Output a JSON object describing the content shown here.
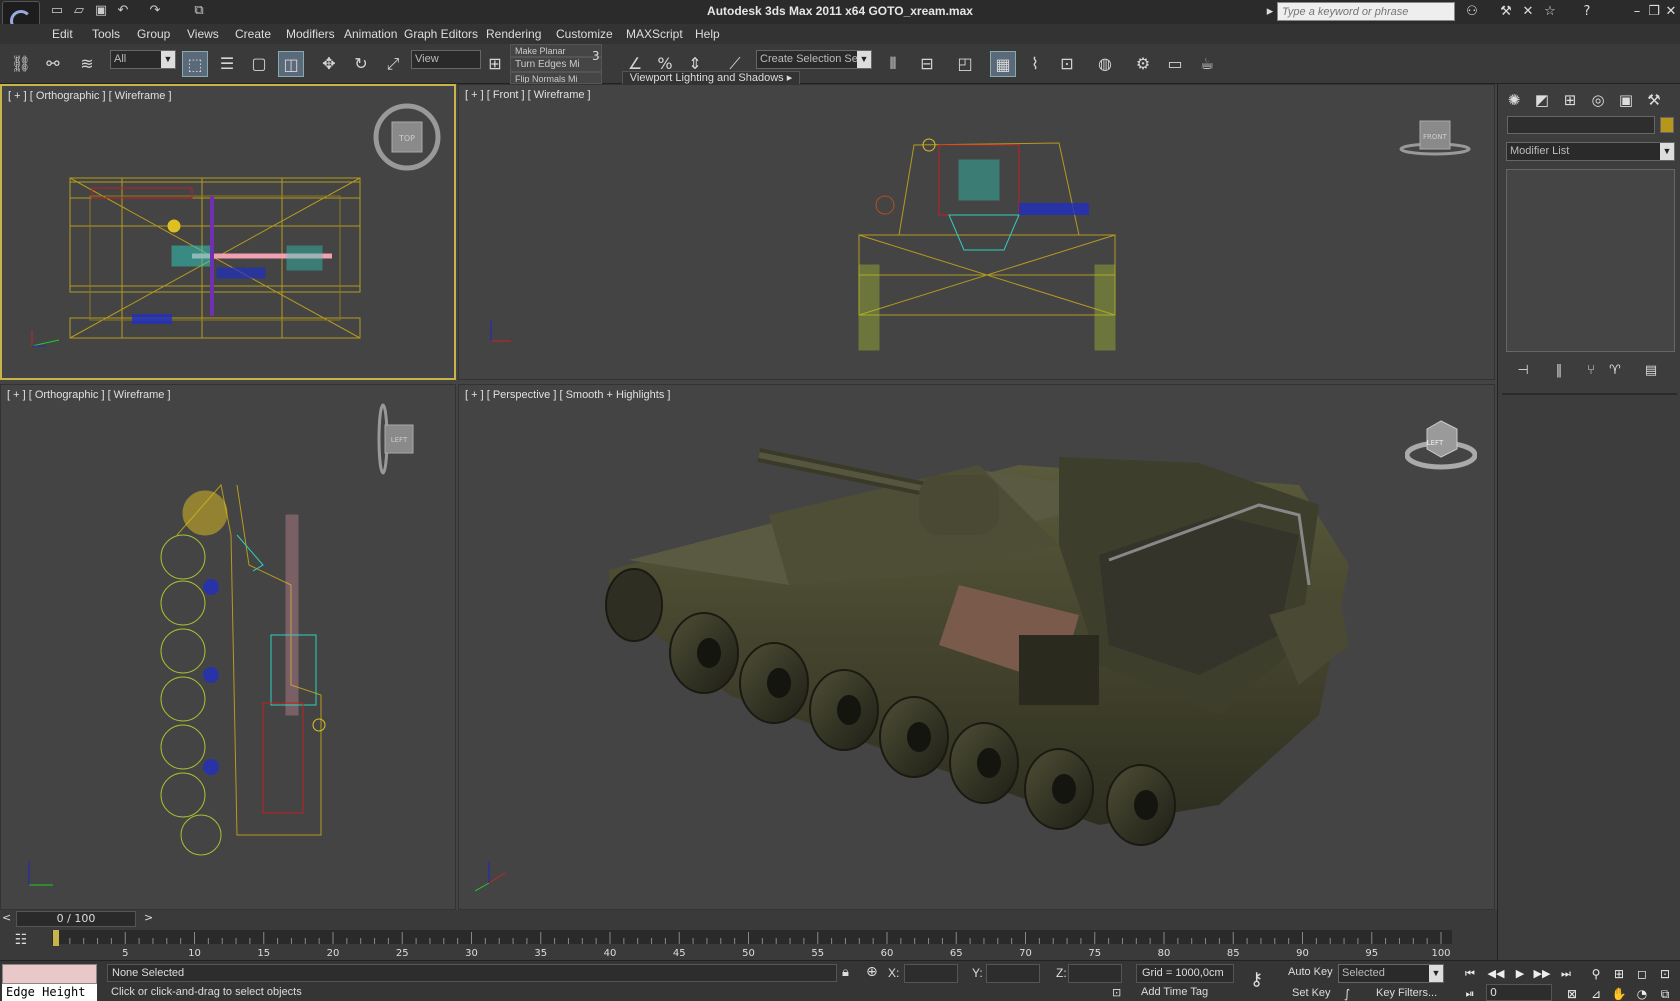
{
  "window": {
    "title": "Autodesk 3ds Max  2011 x64     GOTO_xream.max",
    "search_placeholder": "Type a keyword or phrase"
  },
  "menu": [
    "Edit",
    "Tools",
    "Group",
    "Views",
    "Create",
    "Modifiers",
    "Animation",
    "Graph Editors",
    "Rendering",
    "Customize",
    "MAXScript",
    "Help"
  ],
  "toolbar": {
    "selection_filter": "All",
    "ref_coord": "View",
    "named_selection": "Create Selection Se",
    "make_planar": "Make Planar",
    "turn_edges": "Turn Edges Mi",
    "flip_normals": "Flip Normals Mi",
    "snap_value": "3",
    "lighting_tab": "Viewport Lighting and Shadows"
  },
  "viewports": {
    "top_left": {
      "label": "[ + ] [ Orthographic ] [ Wireframe ]",
      "cube": "TOP"
    },
    "top_right": {
      "label": "[ + ] [ Front ] [ Wireframe ]",
      "cube": "FRONT"
    },
    "bottom_left": {
      "label": "[ + ] [ Orthographic ] [ Wireframe ]",
      "cube": "LEFT"
    },
    "bottom_right": {
      "label": "[ + ] [ Perspective ] [ Smooth + Highlights ]",
      "cube": "LEFT"
    }
  },
  "command_panel": {
    "modifier_list": "Modifier List",
    "object_color": "#b8961a"
  },
  "timeline": {
    "frame_display": "0 / 100",
    "ticks": [
      "5",
      "10",
      "15",
      "20",
      "25",
      "30",
      "35",
      "40",
      "45",
      "50",
      "55",
      "60",
      "65",
      "70",
      "75",
      "80",
      "85",
      "90",
      "95",
      "100"
    ]
  },
  "status": {
    "edge_height": "Edge Height",
    "selection": "None Selected",
    "prompt": "Click or click-and-drag to select objects",
    "x_label": "X:",
    "y_label": "Y:",
    "z_label": "Z:",
    "grid": "Grid = 1000,0cm",
    "add_time_tag": "Add Time Tag",
    "auto_key": "Auto Key",
    "set_key": "Set Key",
    "key_mode": "Selected",
    "key_filters": "Key Filters...",
    "current_frame": "0"
  },
  "colors": {
    "wire_yellow": "#b59a1f",
    "wire_green": "#a8c030",
    "wire_pink": "#f0a0b0",
    "wire_cyan": "#30d0c0",
    "wire_blue": "#2030c0",
    "wire_red": "#c02020",
    "tank_olive": "#4a4a30"
  }
}
